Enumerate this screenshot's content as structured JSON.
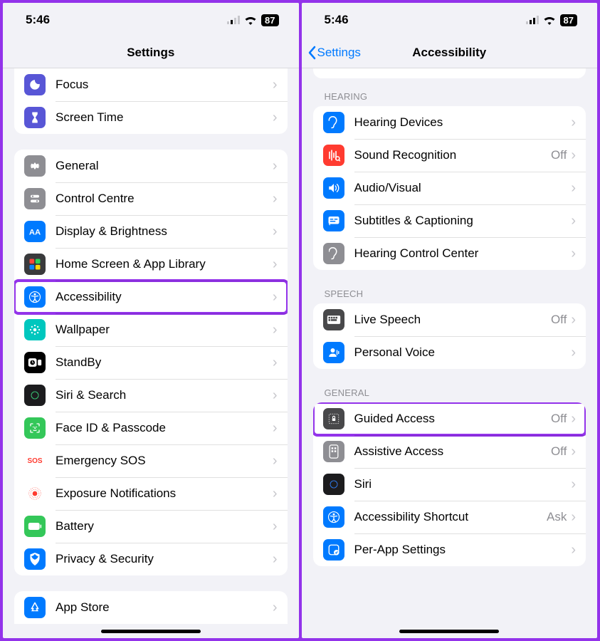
{
  "status": {
    "time": "5:46",
    "battery": "87"
  },
  "left": {
    "title": "Settings",
    "group1": [
      {
        "key": "focus",
        "label": "Focus",
        "bg": "#5856d6"
      },
      {
        "key": "screentime",
        "label": "Screen Time",
        "bg": "#5856d6"
      }
    ],
    "group2": [
      {
        "key": "general",
        "label": "General",
        "bg": "#8e8e93"
      },
      {
        "key": "control",
        "label": "Control Centre",
        "bg": "#8e8e93"
      },
      {
        "key": "display",
        "label": "Display & Brightness",
        "bg": "#007aff"
      },
      {
        "key": "home",
        "label": "Home Screen & App Library",
        "bg": "#3a3a3c"
      },
      {
        "key": "accessibility",
        "label": "Accessibility",
        "bg": "#007aff",
        "highlight": true
      },
      {
        "key": "wallpaper",
        "label": "Wallpaper",
        "bg": "#00c7be"
      },
      {
        "key": "standby",
        "label": "StandBy",
        "bg": "#000000"
      },
      {
        "key": "siri",
        "label": "Siri & Search",
        "bg": "#1c1c1e"
      },
      {
        "key": "faceid",
        "label": "Face ID & Passcode",
        "bg": "#34c759"
      },
      {
        "key": "sos",
        "label": "Emergency SOS",
        "bg": "#ffffff",
        "fg": "#ff3b30",
        "text": "SOS"
      },
      {
        "key": "exposure",
        "label": "Exposure Notifications",
        "bg": "#ffffff"
      },
      {
        "key": "battery",
        "label": "Battery",
        "bg": "#34c759"
      },
      {
        "key": "privacy",
        "label": "Privacy & Security",
        "bg": "#007aff"
      }
    ],
    "group3": [
      {
        "key": "appstore",
        "label": "App Store",
        "bg": "#007aff"
      }
    ]
  },
  "right": {
    "back": "Settings",
    "title": "Accessibility",
    "hearing_header": "HEARING",
    "speech_header": "SPEECH",
    "general_header": "GENERAL",
    "hearing": [
      {
        "key": "hearingdev",
        "label": "Hearing Devices",
        "bg": "#007aff"
      },
      {
        "key": "soundrec",
        "label": "Sound Recognition",
        "bg": "#ff3b30",
        "detail": "Off"
      },
      {
        "key": "audiovisual",
        "label": "Audio/Visual",
        "bg": "#007aff"
      },
      {
        "key": "subtitles",
        "label": "Subtitles & Captioning",
        "bg": "#007aff"
      },
      {
        "key": "hearingctrl",
        "label": "Hearing Control Center",
        "bg": "#8e8e93"
      }
    ],
    "speech": [
      {
        "key": "livespeech",
        "label": "Live Speech",
        "bg": "#48484a",
        "detail": "Off"
      },
      {
        "key": "personalvoice",
        "label": "Personal Voice",
        "bg": "#007aff"
      }
    ],
    "general": [
      {
        "key": "guided",
        "label": "Guided Access",
        "bg": "#48484a",
        "detail": "Off",
        "highlight": true
      },
      {
        "key": "assistive",
        "label": "Assistive Access",
        "bg": "#8e8e93",
        "detail": "Off"
      },
      {
        "key": "siri2",
        "label": "Siri",
        "bg": "#1c1c1e"
      },
      {
        "key": "shortcut",
        "label": "Accessibility Shortcut",
        "bg": "#007aff",
        "detail": "Ask"
      },
      {
        "key": "perapp",
        "label": "Per-App Settings",
        "bg": "#007aff"
      }
    ]
  }
}
